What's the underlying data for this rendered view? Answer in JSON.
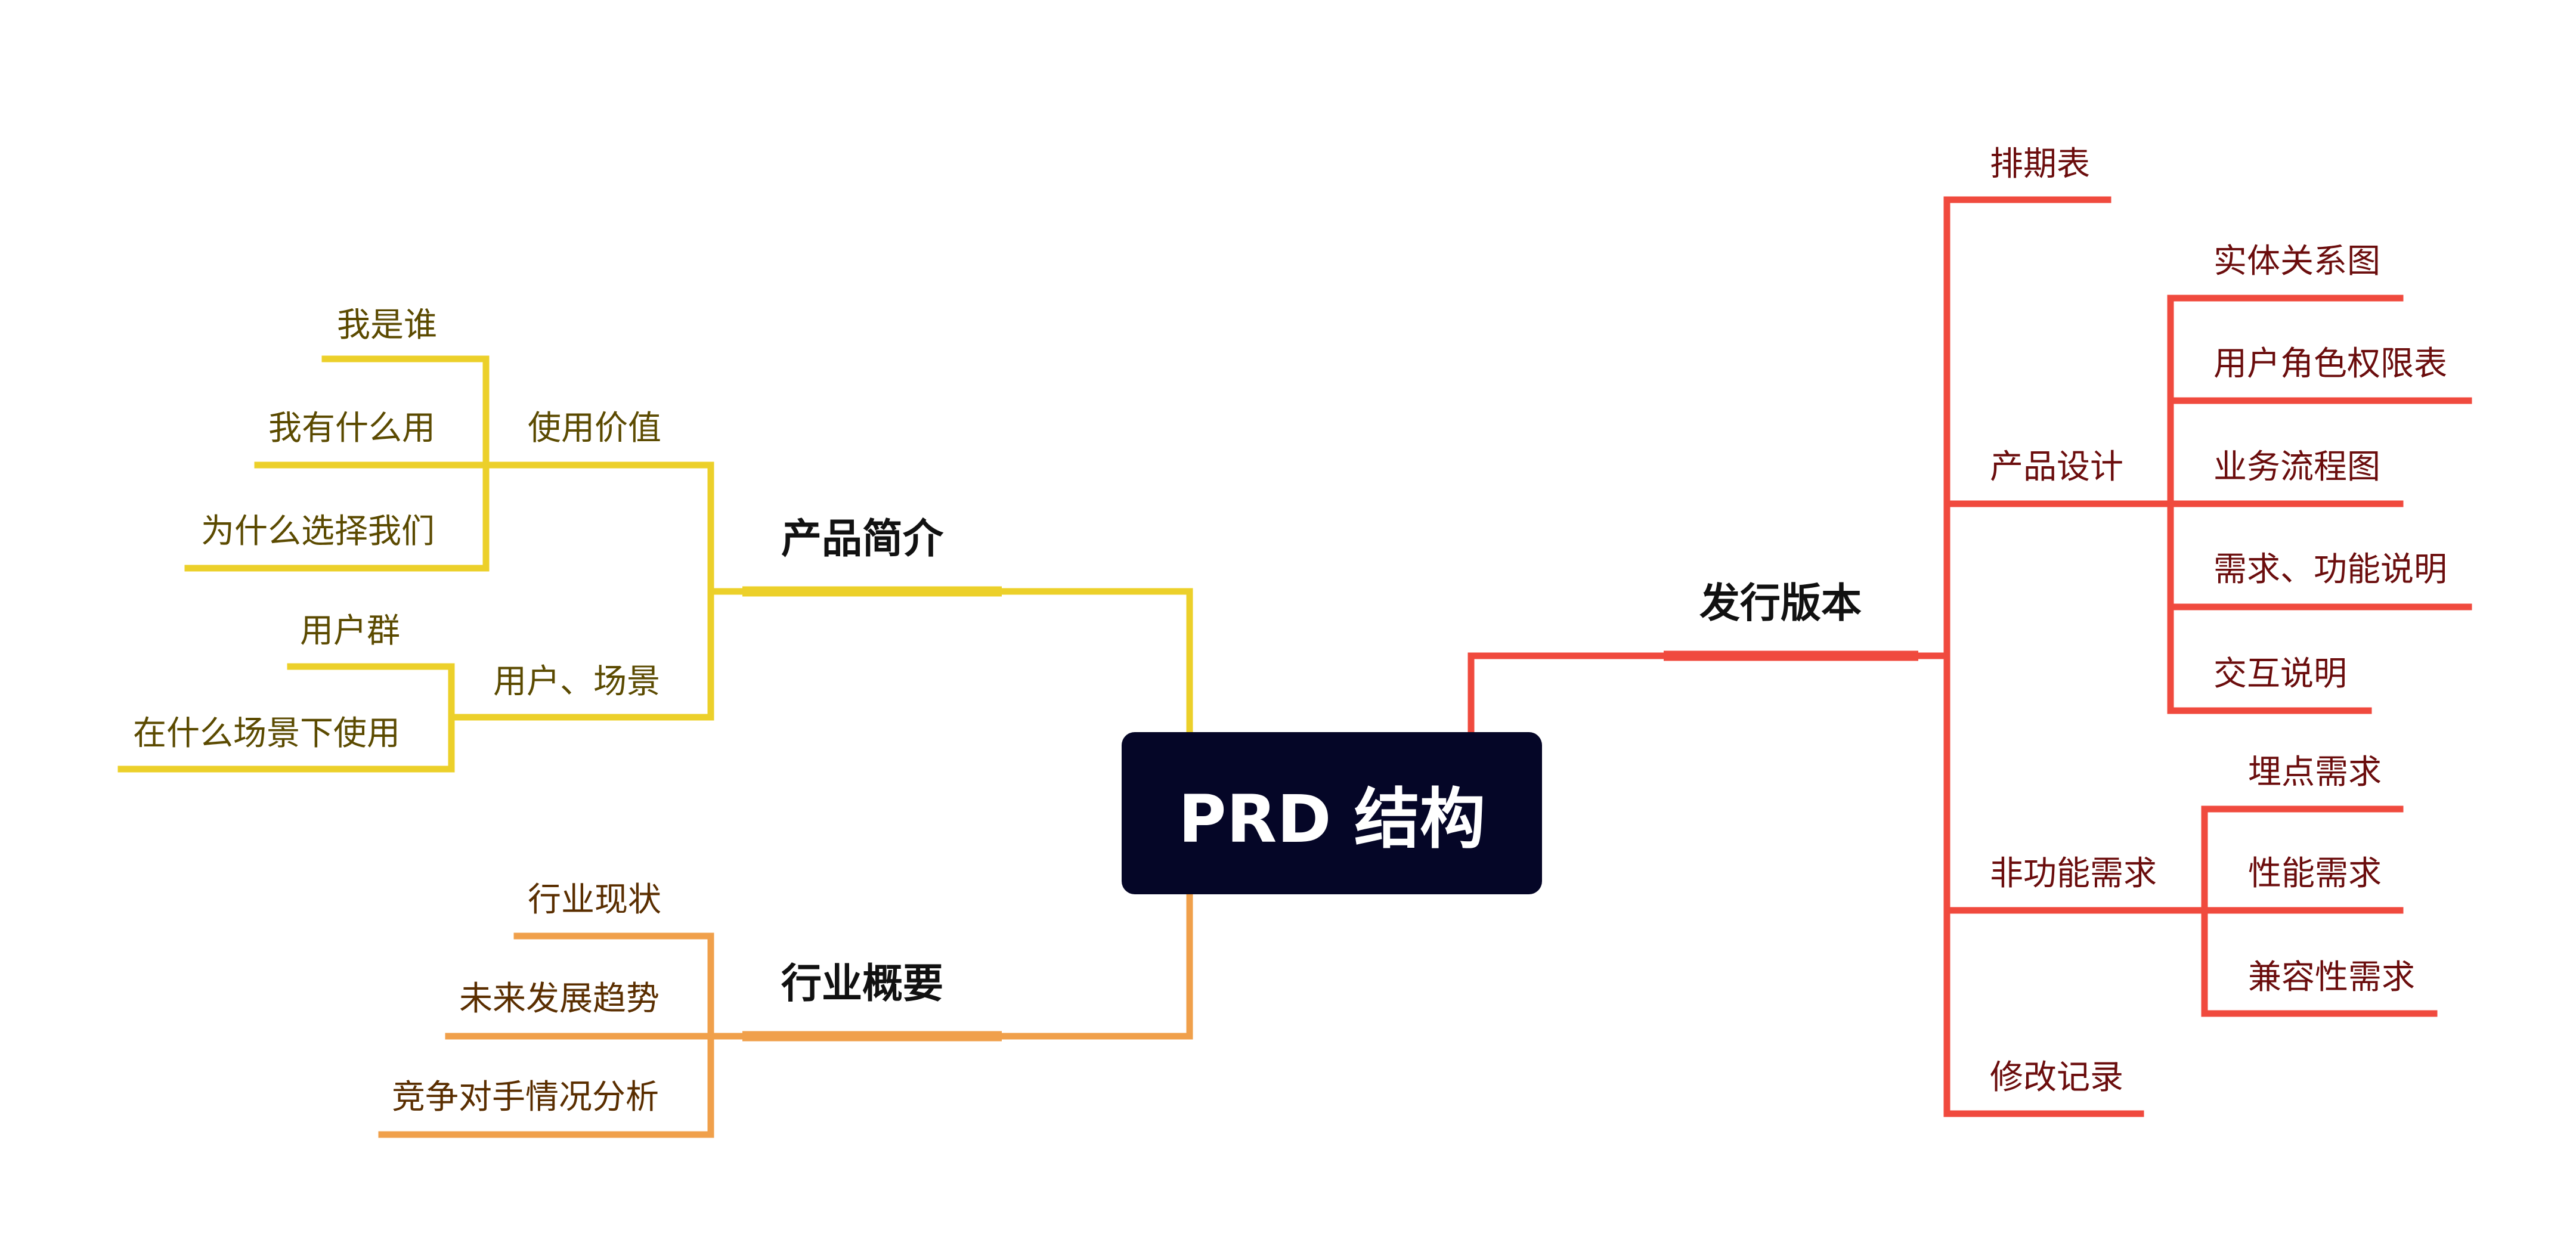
{
  "root": {
    "title": "PRD 结构",
    "fill": "#050627"
  },
  "colors": {
    "yellow": "#ECD02A",
    "orange": "#F0A04B",
    "red": "#F04A3E"
  },
  "branches": {
    "product_intro": {
      "label": "产品简介",
      "groups": [
        {
          "label": "使用价值",
          "items": [
            "我是谁",
            "我有什么用",
            "为什么选择我们"
          ]
        },
        {
          "label": "用户、场景",
          "items": [
            "用户群",
            "在什么场景下使用"
          ]
        }
      ]
    },
    "industry": {
      "label": "行业概要",
      "items": [
        "行业现状",
        "未来发展趋势",
        "竞争对手情况分析"
      ]
    },
    "release": {
      "label": "发行版本",
      "items": [
        {
          "label": "排期表"
        },
        {
          "label": "产品设计",
          "children": [
            "实体关系图",
            "用户角色权限表",
            "业务流程图",
            "需求、功能说明",
            "交互说明"
          ]
        },
        {
          "label": "非功能需求",
          "children": [
            "埋点需求",
            "性能需求",
            "兼容性需求"
          ]
        },
        {
          "label": "修改记录"
        }
      ]
    }
  }
}
